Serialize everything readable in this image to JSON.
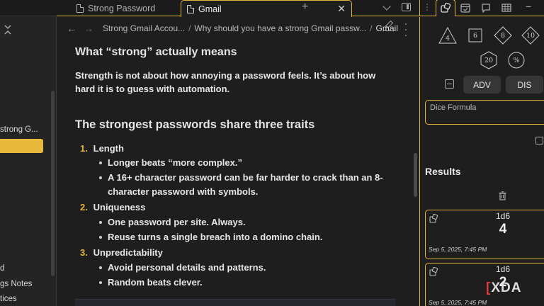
{
  "tabs": [
    {
      "label": "Strong Password",
      "active": false
    },
    {
      "label": "Gmail",
      "active": true
    }
  ],
  "breadcrumb": {
    "items": [
      "Strong Gmail Accou...",
      "Why should you have a strong Gmail passw..."
    ],
    "current": "Gmail",
    "separator": "/"
  },
  "sidebar": {
    "items": [
      "strong G...",
      "d",
      "gs Notes",
      "tices"
    ]
  },
  "note": {
    "section_heading": "What “strong” actually means",
    "intro": "Strength is not about how annoying a password feels. It’s about how hard it is to guess with automation.",
    "heading": "The strongest passwords share three traits",
    "traits": [
      {
        "num": "1.",
        "title": "Length",
        "points": [
          "Longer beats “more complex.”",
          "A 16+ character password can be far harder to crack than an 8-character password with symbols."
        ]
      },
      {
        "num": "2.",
        "title": "Uniqueness",
        "points": [
          "One password per site. Always.",
          "Reuse turns a single breach into a domino chain."
        ]
      },
      {
        "num": "3.",
        "title": "Unpredictability",
        "points": [
          "Avoid personal details and patterns.",
          "Random beats clever."
        ]
      }
    ]
  },
  "dice_panel": {
    "dice": [
      "4",
      "6",
      "8",
      "10",
      "20",
      "%"
    ],
    "adv_label": "ADV",
    "dis_label": "DIS",
    "formula_placeholder": "Dice Formula",
    "results_heading": "Results",
    "results": [
      {
        "formula": "1d6",
        "value": "4",
        "timestamp": "Sep 5, 2025, 7:45 PM"
      },
      {
        "formula": "1d6",
        "value": "2",
        "timestamp": "Sep 5, 2025, 7:45 PM"
      }
    ]
  },
  "watermark": {
    "text": "XDA",
    "brand_color": "#e23a45"
  },
  "colors": {
    "accent": "#e5b53a",
    "background": "#1e1e1e"
  }
}
